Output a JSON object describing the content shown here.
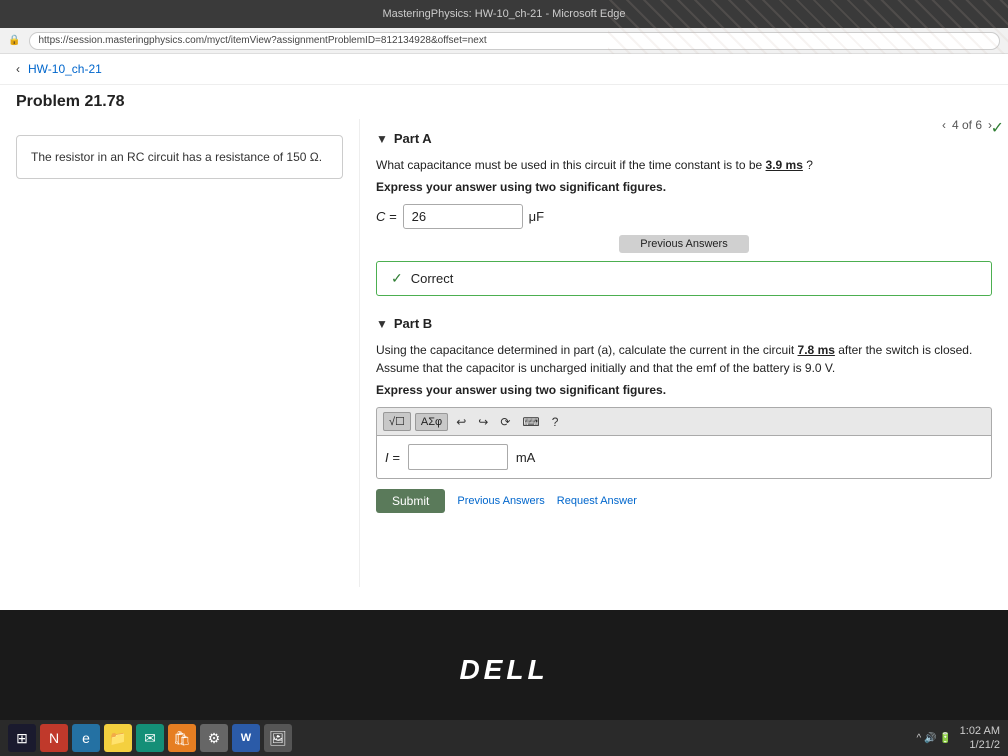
{
  "browser": {
    "title": "MasteringPhysics: HW-10_ch-21 - Microsoft Edge",
    "address": "https://session.masteringphysics.com/myct/itemView?assignmentProblemID=812134928&offset=next"
  },
  "nav": {
    "back_label": "HW-10_ch-21"
  },
  "problem": {
    "title": "Problem 21.78",
    "page_counter": "4 of 6"
  },
  "sidebar": {
    "description": "The resistor in an RC circuit has a resistance of 150 Ω."
  },
  "part_a": {
    "label": "Part A",
    "question": "What capacitance must be used in this circuit if the time constant is to be 3.9 ms ?",
    "sig_figs_note": "Express your answer using two significant figures.",
    "answer_label": "C =",
    "answer_value": "26",
    "answer_unit": "μF",
    "prev_answers_btn": "Previous Answers",
    "correct_label": "Correct"
  },
  "part_b": {
    "label": "Part B",
    "question": "Using the capacitance determined in part (a), calculate the current in the circuit 7.8 ms after the switch is closed. Assume that the capacitor is uncharged initially and that the emf of the battery is 9.0 V.",
    "sig_figs_note": "Express your answer using two significant figures.",
    "answer_label": "I =",
    "answer_unit": "mA",
    "toolbar": {
      "sqrt_btn": "√☐",
      "greek_btn": "ΑΣφ",
      "undo_icon": "↩",
      "redo_icon": "↪",
      "reset_icon": "⟳",
      "keyboard_icon": "⌨",
      "help_icon": "?"
    },
    "submit_btn": "Submit",
    "prev_answers_link": "Previous Answers",
    "request_answer_link": "Request Answer"
  },
  "taskbar": {
    "time": "1:02 AM",
    "date": "1/21/2",
    "start_icon": "⊞"
  },
  "dell": {
    "logo": "DELL"
  }
}
